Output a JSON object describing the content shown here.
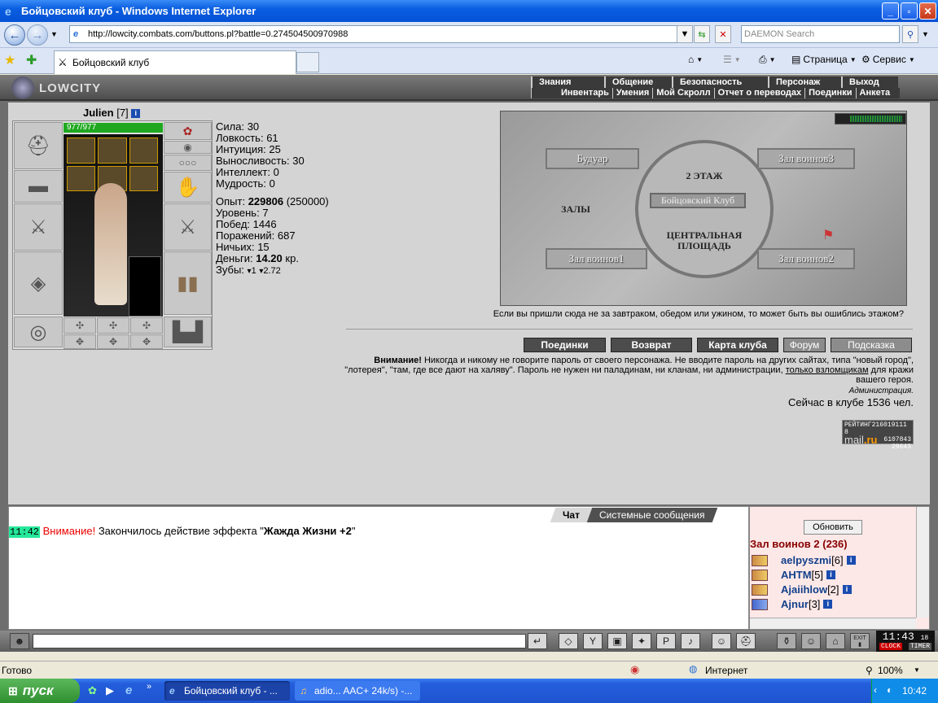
{
  "window": {
    "title": "Бойцовский клуб - Windows Internet Explorer"
  },
  "browser": {
    "url": "http://lowcity.combats.com/buttons.pl?battle=0.274504500970988",
    "search_placeholder": "DAEMON Search",
    "tab_title": "Бойцовский клуб",
    "cmd_page": "Страница",
    "cmd_service": "Сервис"
  },
  "game": {
    "logo": "LOWCITY",
    "menu_top": [
      "Знания",
      "Общение",
      "Безопасность",
      "Персонаж",
      "Выход"
    ],
    "menu_bottom": [
      "Инвентарь",
      "Умения",
      "Мой Скролл",
      "Отчет о переводах",
      "Поединки",
      "Анкета"
    ],
    "character": {
      "name": "Julien",
      "level": "[7]",
      "hp": "977/977",
      "stats": [
        {
          "label": "Сила:",
          "value": "30"
        },
        {
          "label": "Ловкость:",
          "value": "61"
        },
        {
          "label": "Интуиция:",
          "value": "25"
        },
        {
          "label": "Выносливость:",
          "value": "30"
        },
        {
          "label": "Интеллект:",
          "value": "0"
        },
        {
          "label": "Мудрость:",
          "value": "0"
        }
      ],
      "exp_label": "Опыт:",
      "exp_value": "229806",
      "exp_next": "(250000)",
      "level_label": "Уровень:",
      "level_value": "7",
      "wins_label": "Побед:",
      "wins_value": "1446",
      "losses_label": "Поражений:",
      "losses_value": "687",
      "draws_label": "Ничьих:",
      "draws_value": "15",
      "money_label": "Деньги:",
      "money_value": "14.20",
      "money_unit": "кр.",
      "teeth_label": "Зубы:",
      "teeth_1": "1",
      "teeth_2": "2.72"
    },
    "map": {
      "rooms": {
        "boudoir": "Будуар",
        "hall3": "Зал воинов3",
        "hall1": "Зал воинов1",
        "hall2": "Зал воинов2"
      },
      "floor2": "2 ЭТАЖ",
      "club": "Бойцовский Клуб",
      "halls": "ЗАЛЫ",
      "square": "ЦЕНТРАЛЬНАЯ ПЛОЩАДЬ",
      "note": "Если вы пришли сюда не за завтраком, обедом или ужином, то может быть вы ошиблись этажом?"
    },
    "buttons": [
      "Поединки",
      "Возврат",
      "Карта клуба",
      "Форум",
      "Подсказка"
    ],
    "warning": {
      "bold": "Внимание!",
      "text": " Никогда и никому не говорите пароль от своего персонажа. Не вводите пароль на других сайтах, типа \"новый город\", \"лотерея\", \"там, где все дают на халяву\". Пароль не нужен ни паладинам, ни кланам, ни администрации,",
      "underlined": "только взломщикам",
      "tail": " для кражи вашего героя.",
      "admin": "Администрация."
    },
    "online": "Сейчас в клубе 1536 чел.",
    "rating": {
      "label": "РЕЙТИНГ",
      "n1": "216019111 8",
      "n2": "6107843",
      "n3": "29643",
      "brand": "mail",
      "brand2": ".ru"
    },
    "chat": {
      "tab_chat": "Чат",
      "tab_system": "Системные сообщения",
      "time": "11:42",
      "attention": "Внимание!",
      "message": " Закончилось действие эффекта \"",
      "effect": "Жажда Жизни +2",
      "end": "\""
    },
    "users": {
      "refresh": "Обновить",
      "room": "Зал воинов 2 (236)",
      "list": [
        {
          "name": "aelpyszmi",
          "level": "[6]"
        },
        {
          "name": "AHTM",
          "level": "[5]"
        },
        {
          "name": "Ajaiihlow",
          "level": "[2]"
        },
        {
          "name": "Ajnur",
          "level": "[3]"
        }
      ]
    },
    "clock": {
      "time": "11:43",
      "sec": "18",
      "clock_label": "CLOCK",
      "timer_label": "TIMER",
      "exit": "EXIT"
    }
  },
  "status": {
    "ready": "Готово",
    "zone": "Интернет",
    "zoom": "100%"
  },
  "taskbar": {
    "start": "пуск",
    "task1": "Бойцовский клуб - ...",
    "task2": "adio... AAC+ 24k/s) -...",
    "time": "10:42"
  }
}
